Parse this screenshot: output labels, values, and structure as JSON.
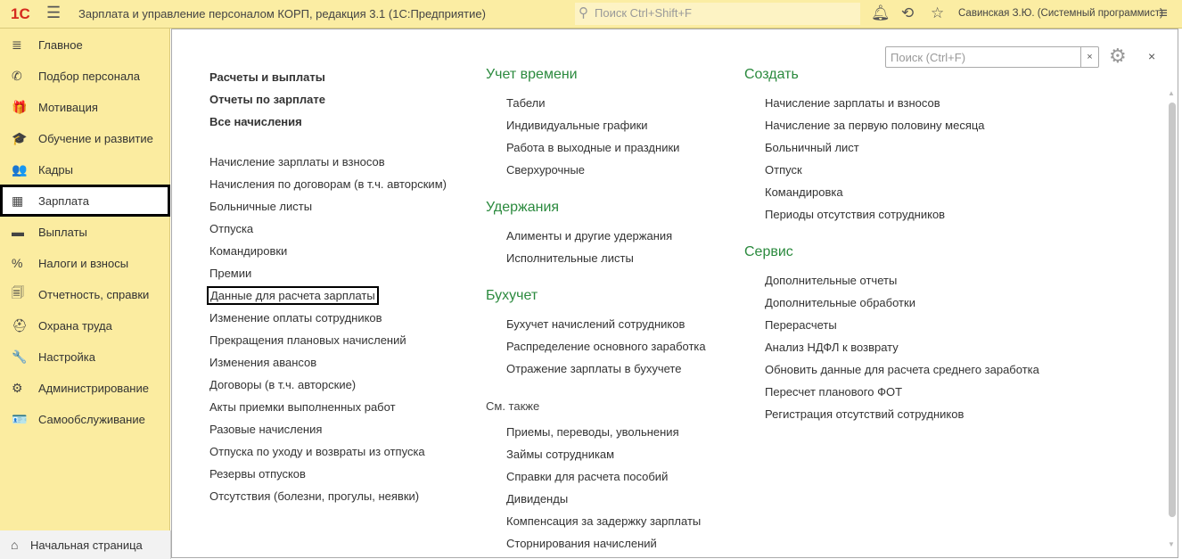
{
  "header": {
    "logo": "1С",
    "title": "Зарплата и управление персоналом КОРП, редакция 3.1  (1С:Предприятие)",
    "search_placeholder": "Поиск Ctrl+Shift+F",
    "user": "Савинская З.Ю. (Системный программист)"
  },
  "sidebar": {
    "items": [
      {
        "label": "Главное",
        "icon": "≣"
      },
      {
        "label": "Подбор персонала",
        "icon": "✆"
      },
      {
        "label": "Мотивация",
        "icon": "🎁"
      },
      {
        "label": "Обучение и развитие",
        "icon": "🎓"
      },
      {
        "label": "Кадры",
        "icon": "👥"
      },
      {
        "label": "Зарплата",
        "icon": "▦"
      },
      {
        "label": "Выплаты",
        "icon": "▬"
      },
      {
        "label": "Налоги и взносы",
        "icon": "%"
      },
      {
        "label": "Отчетность, справки",
        "icon": "🗐"
      },
      {
        "label": "Охрана труда",
        "icon": "⛑"
      },
      {
        "label": "Настройка",
        "icon": "🔧"
      },
      {
        "label": "Администрирование",
        "icon": "⚙"
      },
      {
        "label": "Самообслуживание",
        "icon": "🪪"
      }
    ],
    "selected": "Зарплата"
  },
  "panel": {
    "search_placeholder": "Поиск (Ctrl+F)",
    "clear": "×",
    "close": "×"
  },
  "col1": {
    "bold": [
      "Расчеты и выплаты",
      "Отчеты по зарплате",
      "Все начисления"
    ],
    "items": [
      "Начисление зарплаты и взносов",
      "Начисления по договорам (в т.ч. авторским)",
      "Больничные листы",
      "Отпуска",
      "Командировки",
      "Премии",
      "Данные для расчета зарплаты",
      "Изменение оплаты сотрудников",
      "Прекращения плановых начислений",
      "Изменения авансов",
      "Договоры (в т.ч. авторские)",
      "Акты приемки выполненных работ",
      "Разовые начисления",
      "Отпуска по уходу и возвраты из отпуска",
      "Резервы отпусков",
      "Отсутствия (болезни, прогулы, неявки)"
    ]
  },
  "col2": {
    "groups": [
      {
        "title": "Учет времени",
        "items": [
          "Табели",
          "Индивидуальные графики",
          "Работа в выходные и праздники",
          "Сверхурочные"
        ]
      },
      {
        "title": "Удержания",
        "items": [
          "Алименты и другие удержания",
          "Исполнительные листы"
        ]
      },
      {
        "title": "Бухучет",
        "items": [
          "Бухучет начислений сотрудников",
          "Распределение основного заработка",
          "Отражение зарплаты в бухучете"
        ]
      }
    ],
    "see_also": {
      "title": "См. также",
      "items": [
        "Приемы, переводы, увольнения",
        "Займы сотрудникам",
        "Справки для расчета пособий",
        "Дивиденды",
        "Компенсация за задержку зарплаты",
        "Сторнирования начислений"
      ]
    }
  },
  "col3": {
    "groups": [
      {
        "title": "Создать",
        "items": [
          "Начисление зарплаты и взносов",
          "Начисление за первую половину месяца",
          "Больничный лист",
          "Отпуск",
          "Командировка",
          "Периоды отсутствия сотрудников"
        ]
      },
      {
        "title": "Сервис",
        "items": [
          "Дополнительные отчеты",
          "Дополнительные обработки",
          "Перерасчеты",
          "Анализ НДФЛ к возврату",
          "Обновить данные для расчета среднего заработка",
          "Пересчет планового ФОТ",
          "Регистрация отсутствий сотрудников"
        ]
      }
    ]
  },
  "bottom": {
    "home_tab": "Начальная страница"
  },
  "colors": {
    "topbar": "#fbeda3",
    "sidebar": "#fbeca0",
    "heading": "#2b8a3e"
  }
}
